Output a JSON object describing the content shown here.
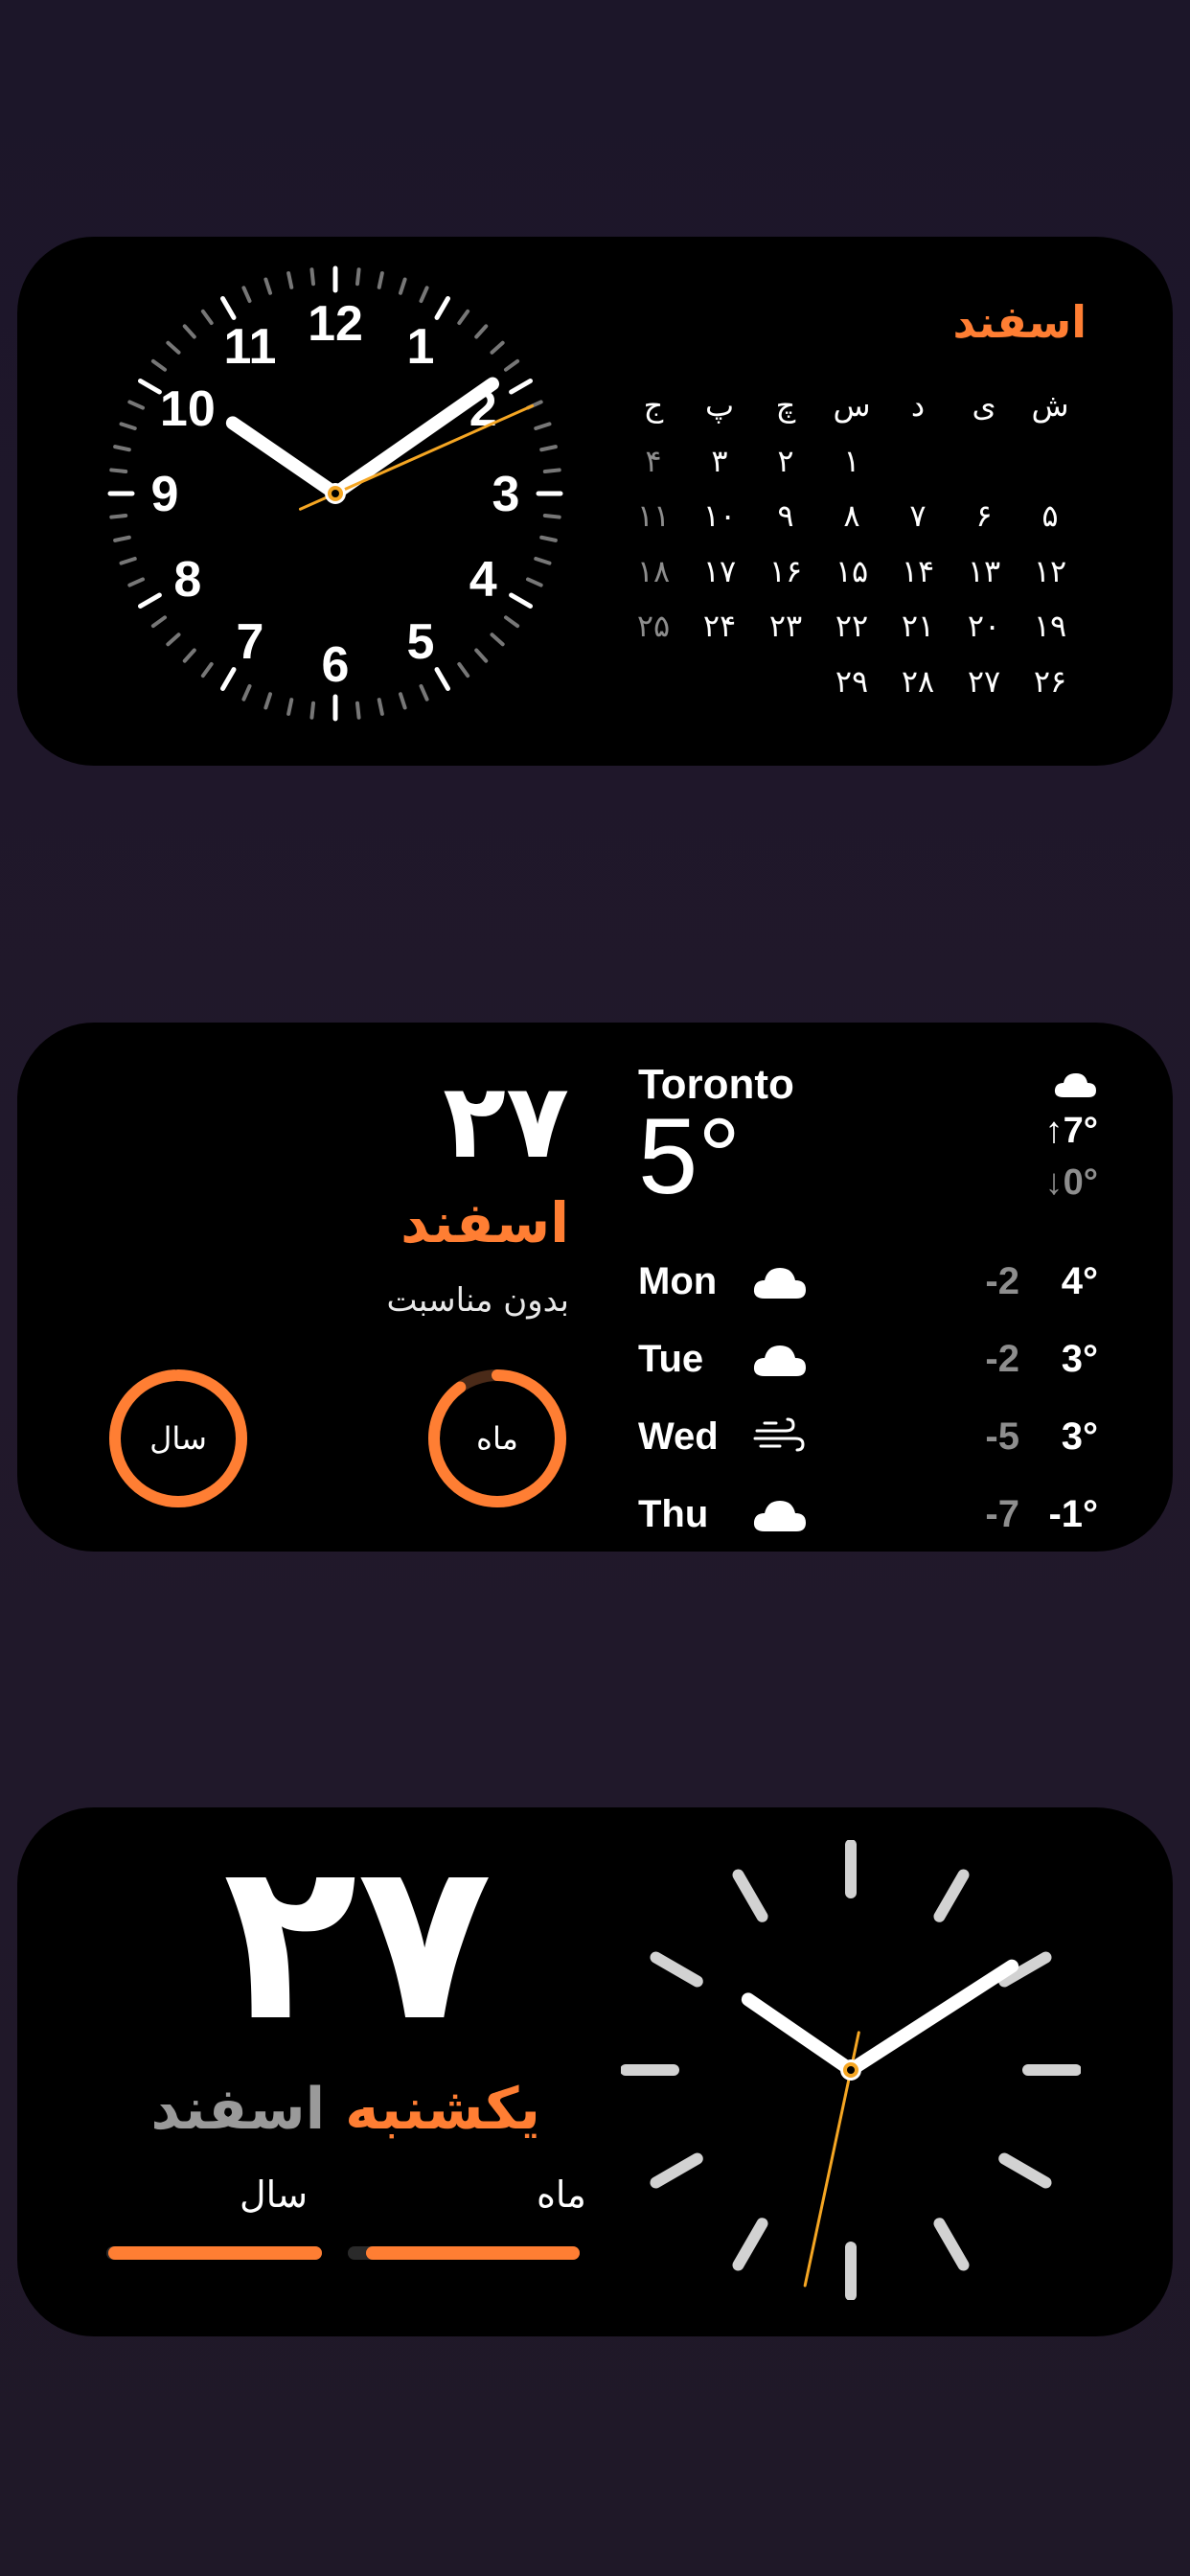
{
  "colors": {
    "accent": "#ff7e33",
    "dim": "#8d8d8d",
    "background": "#1e1729",
    "widget": "#000000"
  },
  "clock_widget": {
    "numerals": [
      "12",
      "1",
      "2",
      "3",
      "4",
      "5",
      "6",
      "7",
      "8",
      "9",
      "10",
      "11"
    ],
    "time": {
      "hour": 10,
      "minute": 9,
      "second": 11
    }
  },
  "calendar_widget": {
    "month_title": "اسفند",
    "weekday_headers": [
      "ش",
      "ی",
      "د",
      "س",
      "چ",
      "پ",
      "ج"
    ],
    "rows": [
      [
        "",
        "",
        "",
        "۱",
        "۲",
        "۳",
        "۴"
      ],
      [
        "۵",
        "۶",
        "۷",
        "۸",
        "۹",
        "۱۰",
        "۱۱"
      ],
      [
        "۱۲",
        "۱۳",
        "۱۴",
        "۱۵",
        "۱۶",
        "۱۷",
        "۱۸"
      ],
      [
        "۱۹",
        "۲۰",
        "۲۱",
        "۲۲",
        "۲۳",
        "۲۴",
        "۲۵"
      ],
      [
        "۲۶",
        "۲۷",
        "۲۸",
        "۲۹",
        "",
        "",
        ""
      ]
    ],
    "today": "۲۷"
  },
  "date_widget": {
    "day_number": "۲۷",
    "month_name": "اسفند",
    "occasion": "بدون مناسبت",
    "month_ring_label": "ماه",
    "year_ring_label": "سال",
    "month_progress": 0.9,
    "year_progress": 0.99
  },
  "weather_widget": {
    "city": "Toronto",
    "current_temp": "5°",
    "condition_icon": "cloud-icon",
    "high": "7°",
    "low": "0°",
    "forecast": [
      {
        "day": "Mon",
        "icon": "cloud-icon",
        "low": "-2",
        "high": "4°"
      },
      {
        "day": "Tue",
        "icon": "cloud-icon",
        "low": "-2",
        "high": "3°"
      },
      {
        "day": "Wed",
        "icon": "wind-icon",
        "low": "-5",
        "high": "3°"
      },
      {
        "day": "Thu",
        "icon": "cloud-icon",
        "low": "-7",
        "high": "-1°"
      }
    ]
  },
  "big_date_widget": {
    "day_number": "۲۷",
    "weekday_name": "یکشنبه",
    "month_name": "اسفند",
    "month_label": "ماه",
    "year_label": "سال",
    "month_progress": 0.92,
    "year_progress": 0.99,
    "time": {
      "hour": 10,
      "minute": 9,
      "second": 32
    }
  }
}
